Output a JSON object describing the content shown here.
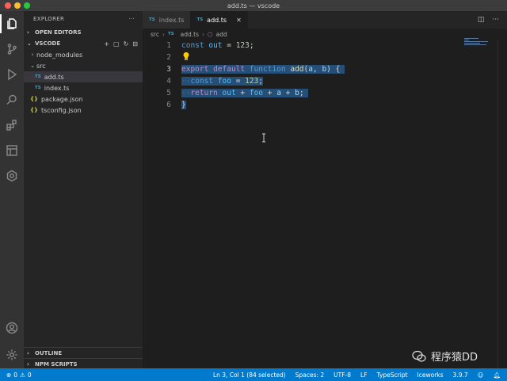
{
  "window": {
    "title": "add.ts — vscode"
  },
  "activity_bar": {
    "icons": [
      "files-icon",
      "source-control-icon",
      "run-debug-icon",
      "search-icon",
      "extensions-icon",
      "remote-explorer-icon",
      "iceworks-icon",
      "account-icon",
      "settings-gear-icon"
    ]
  },
  "sidebar": {
    "title": "EXPLORER",
    "open_editors": "OPEN EDITORS",
    "workspace": "VSCODE",
    "tree": [
      {
        "label": "node_modules",
        "kind": "folder",
        "expanded": false
      },
      {
        "label": "src",
        "kind": "folder",
        "expanded": true
      },
      {
        "label": "add.ts",
        "kind": "ts",
        "selected": true
      },
      {
        "label": "index.ts",
        "kind": "ts"
      },
      {
        "label": "package.json",
        "kind": "json"
      },
      {
        "label": "tsconfig.json",
        "kind": "json"
      }
    ],
    "outline": "OUTLINE",
    "npm_scripts": "NPM SCRIPTS",
    "ts_badge": "TS",
    "json_badge": "{}"
  },
  "tabs": [
    {
      "label": "index.ts",
      "active": false
    },
    {
      "label": "add.ts",
      "active": true
    }
  ],
  "breadcrumb": {
    "folder": "src",
    "file": "add.ts",
    "symbol": "add"
  },
  "editor": {
    "line_numbers": [
      "1",
      "2",
      "3",
      "4",
      "5",
      "6"
    ],
    "code": {
      "l1": {
        "kw": "const",
        "var": "out",
        "eq": " = ",
        "num": "123",
        "end": ";"
      },
      "l3": {
        "export": "export",
        "default": "default",
        "function": "function",
        "name": "add",
        "open": "(",
        "a": "a",
        "comma": ", ",
        "b": "b",
        "close": ") {"
      },
      "l4": {
        "kw": "const",
        "var": "foo",
        "eq": " = ",
        "num": "123",
        "end": ";"
      },
      "l5": {
        "kw": "return",
        "out": "out",
        "plus1": " + ",
        "foo": "foo",
        "plus2": " + ",
        "a": "a",
        "plus3": " + ",
        "b": "b",
        "end": ";"
      },
      "l6": {
        "brace": "}"
      }
    }
  },
  "status_bar": {
    "errors": "0",
    "warnings": "0",
    "position": "Ln 3, Col 1 (84 selected)",
    "spaces": "Spaces: 2",
    "encoding": "UTF-8",
    "eol": "LF",
    "language": "TypeScript",
    "iceworks": "Iceworks",
    "version": "3.9.7"
  },
  "watermark": {
    "text": "程序猿DD"
  },
  "colors": {
    "status": "#007acc",
    "selection": "#264f78",
    "keyword": "#569cd6"
  }
}
